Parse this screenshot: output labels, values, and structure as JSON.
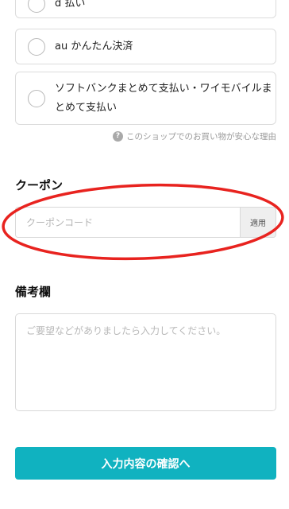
{
  "payment": {
    "options": [
      {
        "label": "d 払い"
      },
      {
        "label": "au かんたん決済"
      },
      {
        "label": "ソフトバンクまとめて支払い・ワイモバイルまとめて支払い"
      }
    ],
    "why_icon": "question-circle-icon",
    "why_text": "このショップでのお買い物が安心な理由"
  },
  "coupon": {
    "title": "クーポン",
    "placeholder": "クーポンコード",
    "apply_label": "適用",
    "highlight_color": "#e8231f"
  },
  "memo": {
    "title": "備考欄",
    "placeholder": "ご要望などがありましたら入力してください。"
  },
  "confirm": {
    "label": "入力内容の確認へ",
    "color": "#10b2c0"
  }
}
